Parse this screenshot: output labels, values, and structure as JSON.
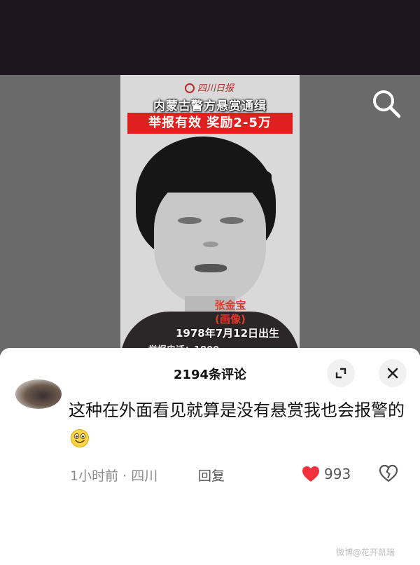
{
  "video": {
    "poster": {
      "source": "四川日报",
      "headline": "内蒙古警方悬赏通缉",
      "reward": "举报有效 奖励2-5万",
      "name": "张金宝",
      "label": "(画像)",
      "born": "1978年7月12日出生",
      "hotline": "举报电话：1800…"
    },
    "search_icon": "search-icon"
  },
  "comments": {
    "title": "2194条评论",
    "expand_icon": "expand-icon",
    "close_icon": "close-icon",
    "item": {
      "text": "这种在外面看见就算是没有悬赏我也会报警的",
      "emoji": "grinning-face-icon",
      "time_location": "1小时前 · 四川",
      "reply_label": "回复",
      "likes": "993",
      "like_icon": "heart-icon",
      "dislike_icon": "broken-heart-icon",
      "like_color": "#f0323c"
    }
  },
  "watermark": "微博@花开凯瑞"
}
